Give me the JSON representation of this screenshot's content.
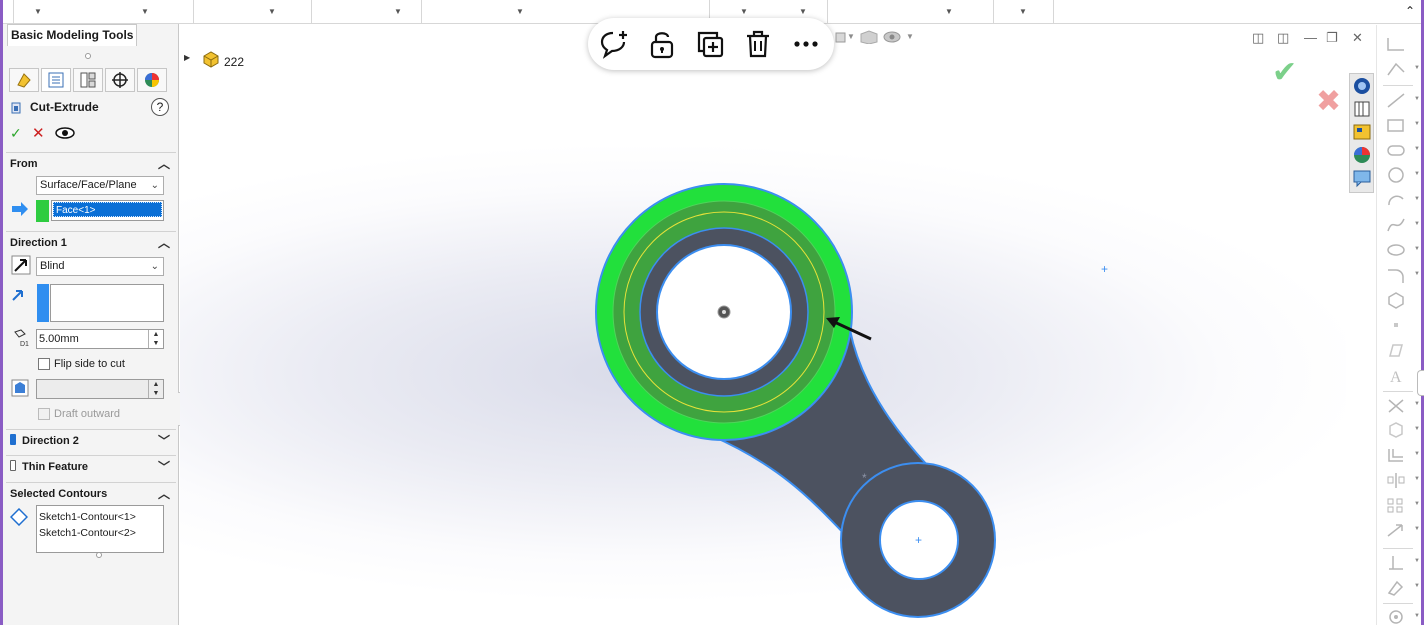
{
  "property_manager": {
    "tab_title": "Basic Modeling Tools",
    "feature_name": "Cut-Extrude",
    "help_label": "?",
    "from": {
      "title": "From",
      "type": "Surface/Face/Plane",
      "selection": "Face<1>"
    },
    "direction1": {
      "title": "Direction 1",
      "end_condition": "Blind",
      "depth": "5.00mm",
      "flip_label": "Flip side to cut",
      "draft_outward_label": "Draft outward",
      "dim_label": "D1"
    },
    "direction2": {
      "title": "Direction 2"
    },
    "thin_feature": {
      "title": "Thin Feature"
    },
    "selected_contours": {
      "title": "Selected Contours",
      "items": [
        "Sketch1-Contour<1>",
        "Sketch1-Contour<2>"
      ]
    }
  },
  "feature_tree": {
    "part_name": "222"
  },
  "colors": {
    "highlight_green": "#22e03c",
    "face_green": "#3fa33f",
    "part_body": "#4c5260",
    "edge_blue": "#3c8ef0",
    "window_border": "#8a5cc4"
  },
  "icons": {
    "floating_bar": [
      "add-comment-icon",
      "lock-icon",
      "copy-icon",
      "delete-icon",
      "more-icon"
    ],
    "task_pane": [
      "solidworks-resources-icon",
      "design-library-icon",
      "file-explorer-icon",
      "appearances-icon",
      "custom-properties-icon"
    ],
    "confirm": [
      "ok-check-icon",
      "cancel-x-icon"
    ]
  }
}
